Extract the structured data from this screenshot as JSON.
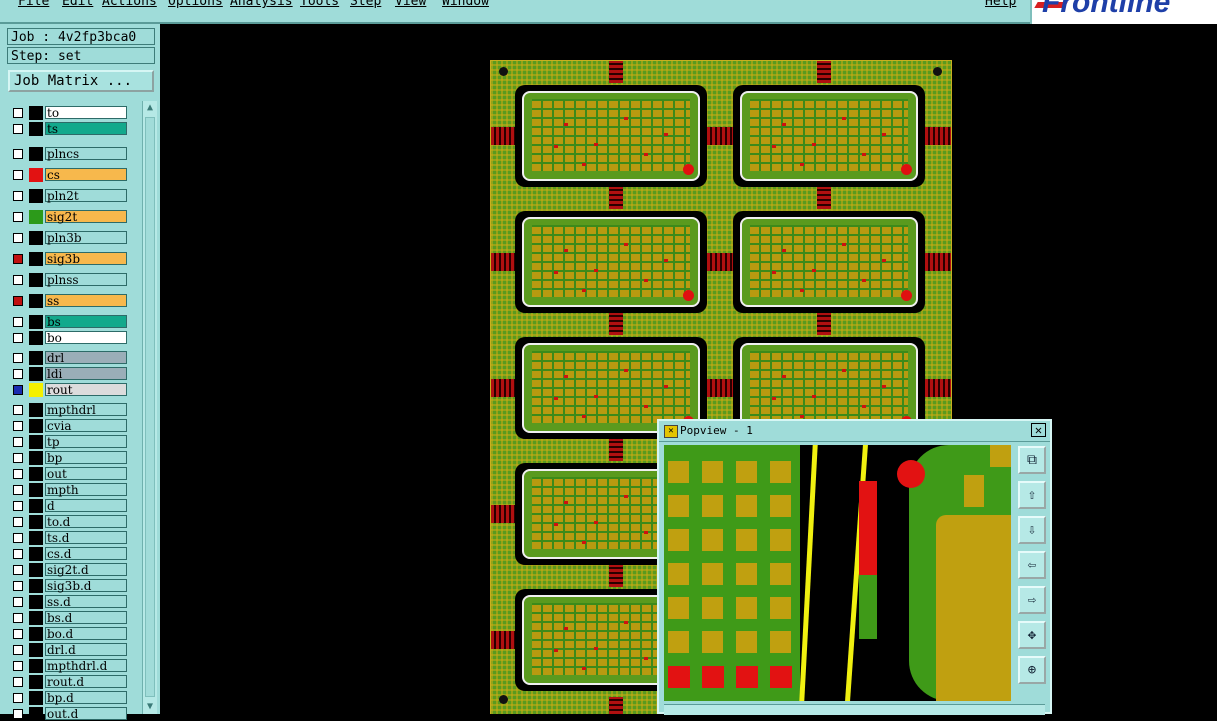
{
  "menubar": {
    "items": [
      "File",
      "Edit",
      "Actions",
      "Options",
      "Analysis",
      "Tools",
      "Step",
      "View",
      "Window"
    ],
    "help": "Help"
  },
  "brand": {
    "name": "Frontline"
  },
  "job": {
    "label": "Job : 4v2fp3bca0",
    "step": "Step: set"
  },
  "job_matrix_button": "Job Matrix ...",
  "layers": [
    {
      "name": "to",
      "color": "#ffffff",
      "swatch": "#000000"
    },
    {
      "name": "ts",
      "color": "#12a98c",
      "swatch": "#000000"
    },
    {
      "name": "plncs",
      "color": "#9fdcd9",
      "swatch": "#000000"
    },
    {
      "name": "cs",
      "color": "#f7b84c",
      "swatch": "#e21212"
    },
    {
      "name": "pln2t",
      "color": "#9fdcd9",
      "swatch": "#000000"
    },
    {
      "name": "sig2t",
      "color": "#f7b84c",
      "swatch": "#2c9a1a"
    },
    {
      "name": "pln3b",
      "color": "#9fdcd9",
      "swatch": "#000000"
    },
    {
      "name": "sig3b",
      "color": "#f7b84c",
      "swatch": "#000000",
      "checkbox": "#c01010"
    },
    {
      "name": "plnss",
      "color": "#9fdcd9",
      "swatch": "#000000"
    },
    {
      "name": "ss",
      "color": "#f7b84c",
      "swatch": "#000000",
      "checkbox": "#c01010"
    },
    {
      "name": "bs",
      "color": "#12a98c",
      "swatch": "#000000"
    },
    {
      "name": "bo",
      "color": "#ffffff",
      "swatch": "#000000"
    },
    {
      "name": "drl",
      "color": "#9aaeb8",
      "swatch": "#000000"
    },
    {
      "name": "ldi",
      "color": "#9aaeb8",
      "swatch": "#000000"
    },
    {
      "name": "rout",
      "color": "#dcdcdc",
      "swatch": "#f4f000",
      "checkbox": "#1a2bb0"
    },
    {
      "name": "mpthdrl",
      "color": "#9fdcd9",
      "swatch": "#000000"
    },
    {
      "name": "cvia",
      "color": "#9fdcd9",
      "swatch": "#000000"
    },
    {
      "name": "tp",
      "color": "#9fdcd9",
      "swatch": "#000000"
    },
    {
      "name": "bp",
      "color": "#9fdcd9",
      "swatch": "#000000"
    },
    {
      "name": "out",
      "color": "#9fdcd9",
      "swatch": "#000000"
    },
    {
      "name": "mpth",
      "color": "#9fdcd9",
      "swatch": "#000000"
    },
    {
      "name": "d",
      "color": "#9fdcd9",
      "swatch": "#000000"
    },
    {
      "name": "to.d",
      "color": "#9fdcd9",
      "swatch": "#000000"
    },
    {
      "name": "ts.d",
      "color": "#9fdcd9",
      "swatch": "#000000"
    },
    {
      "name": "cs.d",
      "color": "#9fdcd9",
      "swatch": "#000000"
    },
    {
      "name": "sig2t.d",
      "color": "#9fdcd9",
      "swatch": "#000000"
    },
    {
      "name": "sig3b.d",
      "color": "#9fdcd9",
      "swatch": "#000000"
    },
    {
      "name": "ss.d",
      "color": "#9fdcd9",
      "swatch": "#000000"
    },
    {
      "name": "bs.d",
      "color": "#9fdcd9",
      "swatch": "#000000"
    },
    {
      "name": "bo.d",
      "color": "#9fdcd9",
      "swatch": "#000000"
    },
    {
      "name": "drl.d",
      "color": "#9fdcd9",
      "swatch": "#000000"
    },
    {
      "name": "mpthdrl.d",
      "color": "#9fdcd9",
      "swatch": "#000000"
    },
    {
      "name": "rout.d",
      "color": "#9fdcd9",
      "swatch": "#000000"
    },
    {
      "name": "bp.d",
      "color": "#9fdcd9",
      "swatch": "#000000"
    },
    {
      "name": "out.d",
      "color": "#9fdcd9",
      "swatch": "#000000"
    }
  ],
  "popview": {
    "title": "Popview - 1",
    "tools": [
      "zoom-window-icon",
      "pan-up-icon",
      "pan-down-icon",
      "pan-left-icon",
      "pan-right-icon",
      "zoom-in-icon",
      "zoom-out-icon"
    ]
  },
  "colors": {
    "ui": "#9fdcd9",
    "panel": "#5a9a1e",
    "copper": "#c0a010",
    "pad_red": "#e21212"
  }
}
